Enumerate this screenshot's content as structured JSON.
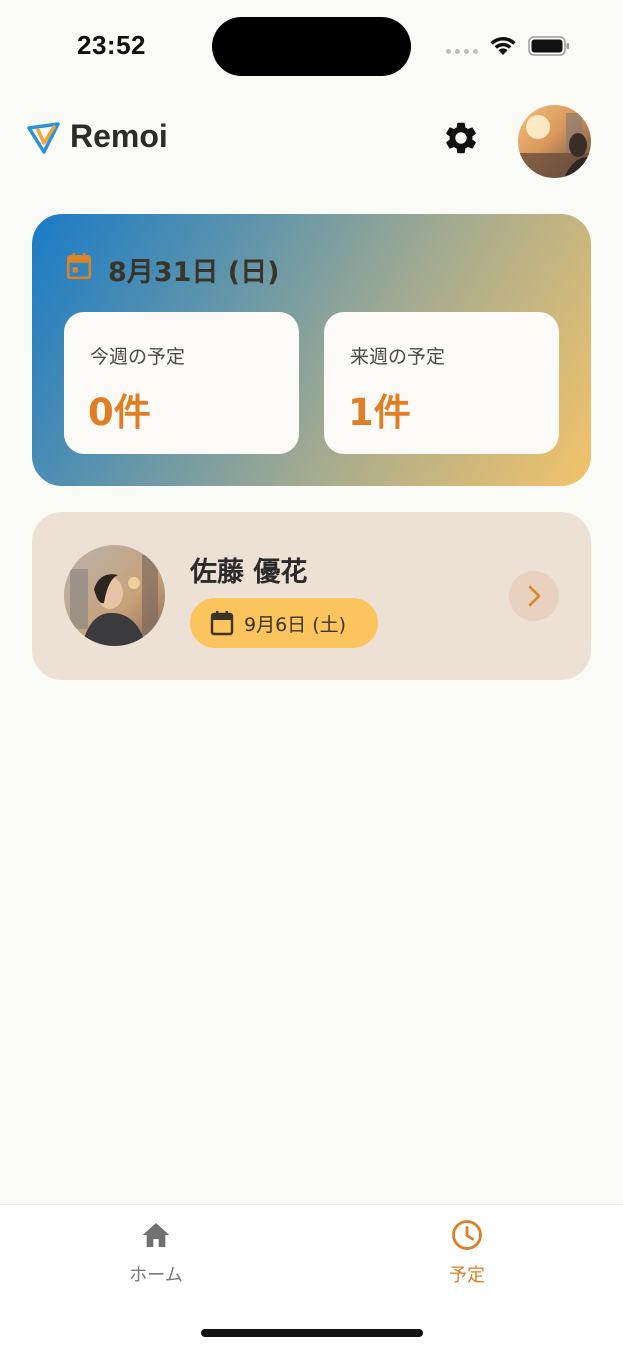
{
  "status_bar": {
    "time": "23:52"
  },
  "header": {
    "app_title": "Remoi",
    "logo_icon": "remoi-logo-icon",
    "settings_icon": "gear-icon",
    "profile_avatar": "user-avatar"
  },
  "summary": {
    "date": "8月31日 (日)",
    "date_icon": "calendar-icon",
    "this_week": {
      "label": "今週の予定",
      "value": "0件"
    },
    "next_week": {
      "label": "来週の予定",
      "value": "1件"
    }
  },
  "appointments": [
    {
      "name": "佐藤 優花",
      "date": "9月6日 (土)",
      "date_icon": "calendar-icon",
      "action_icon": "chevron-right-icon"
    }
  ],
  "tab_bar": {
    "home": {
      "label": "ホーム",
      "icon": "home-icon",
      "active": false
    },
    "schedule": {
      "label": "予定",
      "icon": "clock-icon",
      "active": true
    }
  },
  "colors": {
    "accent": "#e07e23",
    "badge": "#fbc45d",
    "background": "#fafaf6",
    "appointment_card": "#ede0d5"
  }
}
